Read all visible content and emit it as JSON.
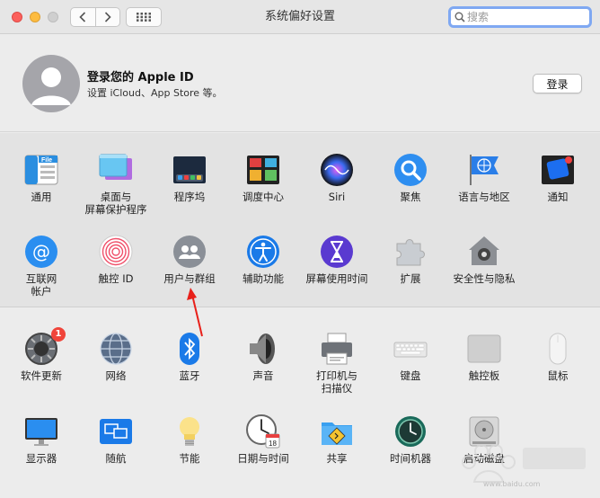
{
  "window": {
    "title": "系统偏好设置"
  },
  "search": {
    "placeholder": "搜索"
  },
  "apple_id": {
    "title": "登录您的 Apple ID",
    "subtitle": "设置 iCloud、App Store 等。",
    "login_label": "登录"
  },
  "panes_row1": [
    {
      "label": "通用",
      "icon": "general-icon"
    },
    {
      "label": "桌面与\n屏幕保护程序",
      "icon": "desktop-screensaver-icon"
    },
    {
      "label": "程序坞",
      "icon": "dock-icon"
    },
    {
      "label": "调度中心",
      "icon": "mission-control-icon"
    },
    {
      "label": "Siri",
      "icon": "siri-icon"
    },
    {
      "label": "聚焦",
      "icon": "spotlight-icon"
    },
    {
      "label": "语言与地区",
      "icon": "language-region-icon"
    },
    {
      "label": "通知",
      "icon": "notifications-icon"
    }
  ],
  "panes_row2": [
    {
      "label": "互联网\n帐户",
      "icon": "internet-accounts-icon"
    },
    {
      "label": "触控 ID",
      "icon": "touch-id-icon"
    },
    {
      "label": "用户与群组",
      "icon": "users-groups-icon"
    },
    {
      "label": "辅助功能",
      "icon": "accessibility-icon"
    },
    {
      "label": "屏幕使用时间",
      "icon": "screen-time-icon"
    },
    {
      "label": "扩展",
      "icon": "extensions-icon"
    },
    {
      "label": "安全性与隐私",
      "icon": "security-privacy-icon"
    }
  ],
  "panes_row3": [
    {
      "label": "软件更新",
      "icon": "software-update-icon",
      "badge": "1"
    },
    {
      "label": "网络",
      "icon": "network-icon"
    },
    {
      "label": "蓝牙",
      "icon": "bluetooth-icon"
    },
    {
      "label": "声音",
      "icon": "sound-icon"
    },
    {
      "label": "打印机与\n扫描仪",
      "icon": "printers-scanners-icon"
    },
    {
      "label": "键盘",
      "icon": "keyboard-icon"
    },
    {
      "label": "触控板",
      "icon": "trackpad-icon"
    },
    {
      "label": "鼠标",
      "icon": "mouse-icon"
    }
  ],
  "panes_row4": [
    {
      "label": "显示器",
      "icon": "displays-icon"
    },
    {
      "label": "随航",
      "icon": "sidecar-icon"
    },
    {
      "label": "节能",
      "icon": "energy-saver-icon"
    },
    {
      "label": "日期与时间",
      "icon": "date-time-icon"
    },
    {
      "label": "共享",
      "icon": "sharing-icon"
    },
    {
      "label": "时间机器",
      "icon": "time-machine-icon"
    },
    {
      "label": "启动磁盘",
      "icon": "startup-disk-icon"
    }
  ],
  "annotation": {
    "arrow_color": "#e8201a",
    "points_to": "用户与群组"
  },
  "watermark": {
    "text": "www.baidu.com"
  }
}
